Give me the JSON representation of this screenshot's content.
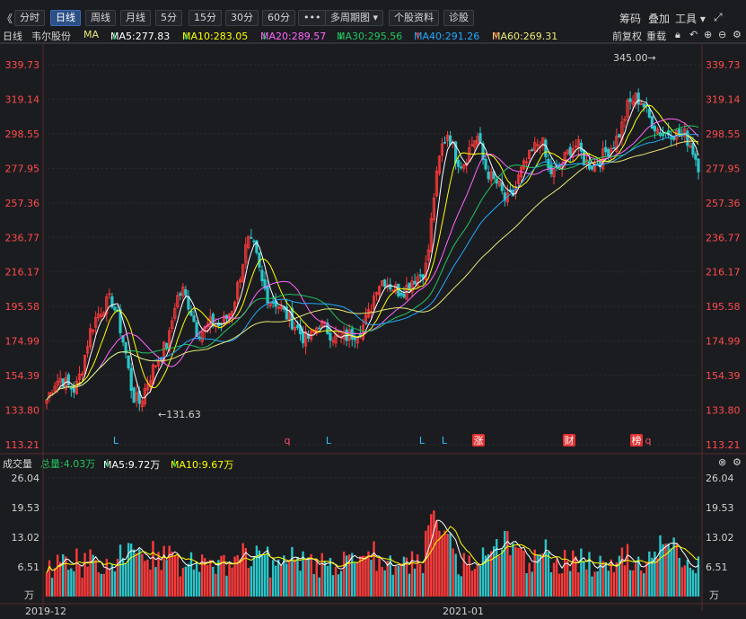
{
  "toolbar": {
    "tabs": [
      "分时",
      "日线",
      "周线",
      "月线",
      "5分",
      "15分",
      "30分",
      "60分"
    ],
    "active_tab": "日线",
    "more_label": "•••",
    "multi_period": "多周期图",
    "stock_info": "个股资料",
    "diagnose": "诊股",
    "chips": "筹码",
    "overlay": "叠加",
    "tools": "工具",
    "nav_left": "《"
  },
  "ma_bar": {
    "period": "日线",
    "stock": "韦尔股份",
    "ma": "MA",
    "ma5": "MA5:277.83",
    "ma10": "MA10:283.05",
    "ma20": "MA20:289.57",
    "ma30": "MA30:295.56",
    "ma40": "MA40:291.26",
    "ma60": "MA60:269.31",
    "adjust": "前复权",
    "chart_label": "重载"
  },
  "vol_bar": {
    "title": "成交量",
    "total": "总量:4.03万",
    "ma5": "MA5:9.72万",
    "ma10": "MA10:9.67万"
  },
  "colors": {
    "ma5": "#ffffff",
    "ma10": "#ffff00",
    "ma20": "#ff66ff",
    "ma30": "#22c55e",
    "ma40": "#22aaff",
    "ma60": "#e8e875",
    "up": "#ff3a3a",
    "down": "#2bc5c9"
  },
  "chart_data": [
    {
      "type": "candlestick",
      "y_ticks": [
        "339.73",
        "319.14",
        "298.55",
        "277.95",
        "257.36",
        "236.77",
        "216.17",
        "195.58",
        "174.99",
        "154.39",
        "133.80",
        "113.21"
      ],
      "ylim": [
        113.21,
        339.73
      ],
      "annotations": {
        "high": "345.00→",
        "low": "←131.63"
      },
      "markers": [
        "L",
        "q",
        "L",
        "L",
        "L",
        "涨",
        "财",
        "榜",
        "q"
      ],
      "x_ticks": [
        "2019-12",
        "2021-01"
      ],
      "close_path": [
        [
          0,
          140
        ],
        [
          8,
          150
        ],
        [
          16,
          153
        ],
        [
          24,
          148
        ],
        [
          32,
          146
        ],
        [
          40,
          160
        ],
        [
          48,
          180
        ],
        [
          56,
          190
        ],
        [
          64,
          196
        ],
        [
          72,
          200
        ],
        [
          80,
          188
        ],
        [
          88,
          168
        ],
        [
          96,
          142
        ],
        [
          104,
          138
        ],
        [
          112,
          150
        ],
        [
          120,
          160
        ],
        [
          128,
          168
        ],
        [
          136,
          175
        ],
        [
          144,
          200
        ],
        [
          152,
          205
        ],
        [
          160,
          195
        ],
        [
          168,
          180
        ],
        [
          176,
          182
        ],
        [
          184,
          186
        ],
        [
          192,
          184
        ],
        [
          200,
          188
        ],
        [
          208,
          196
        ],
        [
          216,
          215
        ],
        [
          224,
          235
        ],
        [
          232,
          230
        ],
        [
          240,
          210
        ],
        [
          248,
          200
        ],
        [
          256,
          198
        ],
        [
          264,
          192
        ],
        [
          272,
          188
        ],
        [
          280,
          182
        ],
        [
          288,
          176
        ],
        [
          296,
          178
        ],
        [
          304,
          186
        ],
        [
          312,
          182
        ],
        [
          320,
          178
        ],
        [
          328,
          176
        ],
        [
          336,
          178
        ],
        [
          344,
          180
        ],
        [
          352,
          183
        ],
        [
          360,
          192
        ],
        [
          368,
          208
        ],
        [
          376,
          212
        ],
        [
          384,
          208
        ],
        [
          392,
          205
        ],
        [
          400,
          206
        ],
        [
          408,
          212
        ],
        [
          416,
          214
        ],
        [
          424,
          220
        ],
        [
          432,
          262
        ],
        [
          440,
          290
        ],
        [
          448,
          300
        ],
        [
          456,
          285
        ],
        [
          464,
          280
        ],
        [
          472,
          290
        ],
        [
          480,
          298
        ],
        [
          488,
          280
        ],
        [
          496,
          272
        ],
        [
          504,
          268
        ],
        [
          512,
          258
        ],
        [
          520,
          262
        ],
        [
          528,
          275
        ],
        [
          536,
          282
        ],
        [
          544,
          290
        ],
        [
          552,
          296
        ],
        [
          560,
          276
        ],
        [
          568,
          275
        ],
        [
          576,
          282
        ],
        [
          584,
          290
        ],
        [
          592,
          292
        ],
        [
          600,
          282
        ],
        [
          608,
          280
        ],
        [
          616,
          282
        ],
        [
          624,
          288
        ],
        [
          632,
          292
        ],
        [
          640,
          300
        ],
        [
          648,
          315
        ],
        [
          656,
          320
        ],
        [
          664,
          318
        ],
        [
          672,
          308
        ],
        [
          680,
          302
        ],
        [
          688,
          298
        ],
        [
          696,
          300
        ],
        [
          704,
          298
        ],
        [
          712,
          298
        ],
        [
          720,
          290
        ],
        [
          727,
          280
        ]
      ]
    },
    {
      "type": "bar",
      "y_ticks": [
        "26.04",
        "19.53",
        "13.02",
        "6.51"
      ],
      "unit": "万",
      "ylim": [
        0,
        26.04
      ]
    }
  ]
}
